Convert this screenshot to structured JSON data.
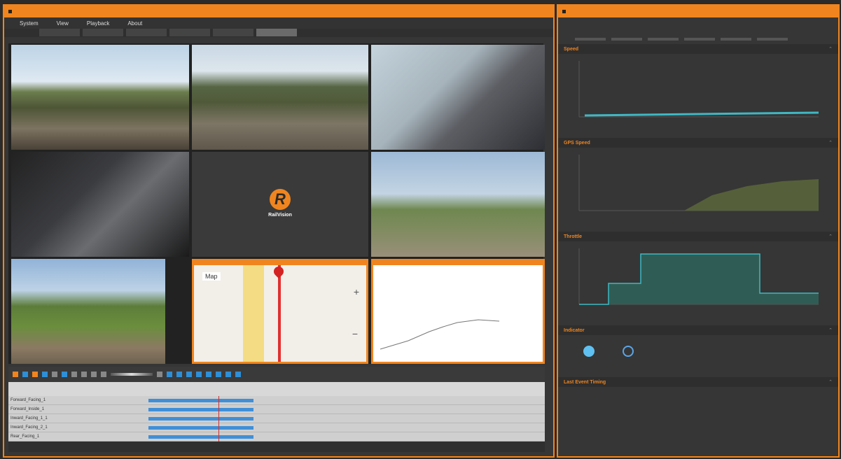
{
  "main_window": {
    "title": "",
    "menu": [
      "System",
      "View",
      "Playback",
      "About"
    ],
    "tabs": [
      "",
      "",
      "",
      "",
      "",
      ""
    ],
    "active_tab": 5
  },
  "video": {
    "cells": [
      {
        "label": "",
        "time": ""
      },
      {
        "label": "",
        "time": ""
      },
      {
        "label": "",
        "time": ""
      },
      {
        "label": "",
        "time": ""
      },
      {
        "label": "",
        "time": ""
      },
      {
        "label": "",
        "time": ""
      }
    ],
    "logo_mark": "R",
    "logo_brand": "RailVision",
    "logo_sub": "",
    "map_label": "Map",
    "map_zoom_plus": "+",
    "map_zoom_minus": "−"
  },
  "timeline": {
    "ruler_ticks": [
      "",
      "",
      "",
      "",
      "",
      "",
      "",
      "",
      ""
    ],
    "rows": [
      "Forward_Facing_1",
      "Forward_Inside_1",
      "Inward_Facing_1_1",
      "Inward_Facing_2_1",
      "Rear_Facing_1"
    ]
  },
  "side_window": {
    "title": "",
    "header": "",
    "panels": [
      {
        "title": "Speed",
        "value": ""
      },
      {
        "title": "GPS Speed",
        "value": ""
      },
      {
        "title": "Throttle",
        "value": ""
      },
      {
        "title": "Indicator",
        "value": ""
      },
      {
        "title": "Last Event Timing",
        "value": ""
      }
    ],
    "indicator_labels": [
      "",
      ""
    ],
    "last_event_value": ""
  },
  "colors": {
    "accent": "#f0851f",
    "bar_blue": "#3f8fd8",
    "line_teal": "#3fb8c4"
  }
}
